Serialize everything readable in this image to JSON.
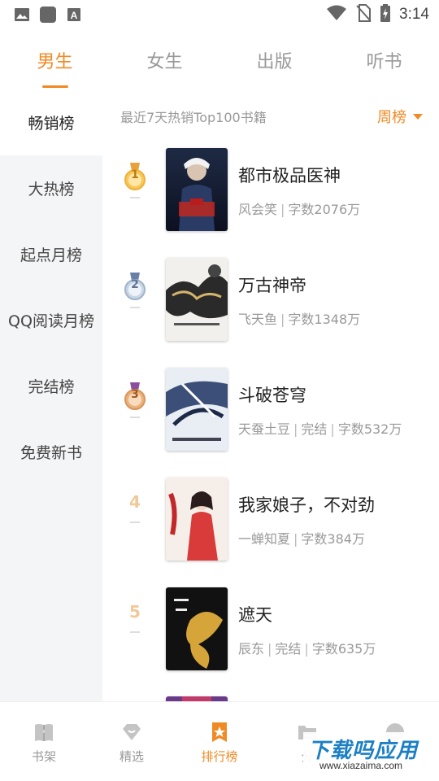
{
  "status_bar": {
    "time": "3:14",
    "left_icons": [
      "image-icon",
      "app-icon",
      "font-icon"
    ],
    "right_icons": [
      "wifi-icon",
      "no-sim-icon",
      "battery-charging-icon"
    ]
  },
  "top_tabs": [
    {
      "label": "男生",
      "active": true
    },
    {
      "label": "女生",
      "active": false
    },
    {
      "label": "出版",
      "active": false
    },
    {
      "label": "听书",
      "active": false
    }
  ],
  "side_nav": [
    {
      "label": "畅销榜",
      "active": true
    },
    {
      "label": "大热榜",
      "active": false
    },
    {
      "label": "起点月榜",
      "active": false
    },
    {
      "label": "QQ阅读月榜",
      "active": false
    },
    {
      "label": "完结榜",
      "active": false
    },
    {
      "label": "免费新书",
      "active": false
    }
  ],
  "filter": {
    "description": "最近7天热销Top100书籍",
    "period": "周榜"
  },
  "books": [
    {
      "rank": "1",
      "title": "都市极品医神",
      "author": "风会笑",
      "status": "",
      "words": "字数2076万"
    },
    {
      "rank": "2",
      "title": "万古神帝",
      "author": "飞天鱼",
      "status": "",
      "words": "字数1348万"
    },
    {
      "rank": "3",
      "title": "斗破苍穹",
      "author": "天蚕土豆",
      "status": "完结",
      "words": "字数532万"
    },
    {
      "rank": "4",
      "title": "我家娘子，不对劲",
      "author": "一蝉知夏",
      "status": "",
      "words": "字数384万"
    },
    {
      "rank": "5",
      "title": "遮天",
      "author": "辰东",
      "status": "完结",
      "words": "字数635万"
    }
  ],
  "bottom_tabs": [
    {
      "label": "书架",
      "icon": "book-icon",
      "active": false
    },
    {
      "label": "精选",
      "icon": "gem-icon",
      "active": false
    },
    {
      "label": "排行榜",
      "icon": "ranking-star-icon",
      "active": true
    },
    {
      "label": "分",
      "icon": "folder-icon",
      "active": false
    },
    {
      "label": "",
      "icon": "profile-icon",
      "active": false
    }
  ],
  "watermark": {
    "text": "下载吗应用",
    "url_text": "www.xiazaima.com"
  },
  "colors": {
    "accent": "#f08a24",
    "medal_gold": "#f0b13a",
    "medal_silver": "#9fb4cc",
    "medal_bronze": "#d9955a",
    "watermark_blue": "#1c7fc5"
  }
}
